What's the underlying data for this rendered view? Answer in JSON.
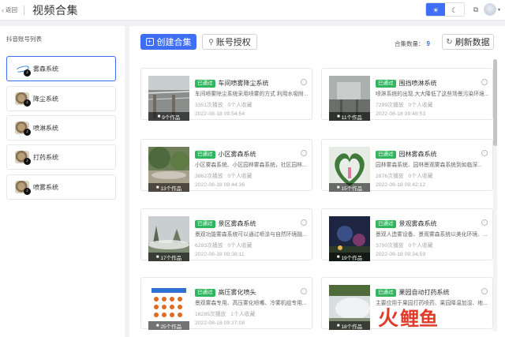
{
  "header": {
    "back_label": "返回",
    "title": "视频合集"
  },
  "sidebar": {
    "title": "抖音账号列表",
    "items": [
      {
        "label": "雾森系统",
        "logo": "blue-swoosh-logo",
        "active": true
      },
      {
        "label": "降尘系统",
        "logo": "circular-photo-logo",
        "active": false
      },
      {
        "label": "喷淋系统",
        "logo": "circular-photo-logo",
        "active": false
      },
      {
        "label": "打药系统",
        "logo": "circular-photo-logo",
        "active": false
      },
      {
        "label": "喷雾系统",
        "logo": "circular-photo-logo",
        "active": false
      }
    ]
  },
  "toolbar": {
    "create_label": "创建合集",
    "auth_label": "账号授权",
    "count_label": "合集数量：",
    "count_value": "9",
    "refresh_label": "刷新数据"
  },
  "cards": [
    {
      "tag": "已通过",
      "title": "车间喷雾降尘系统",
      "desc": "车间喷雾除尘系统采用喷雾的方式 利用水吸附...",
      "plays": "3351次播放",
      "favs": "0个人收藏",
      "date": "2022-08-18 09:54:54",
      "works": "9个作品"
    },
    {
      "tag": "已通过",
      "title": "围挡喷淋系统",
      "desc": "喷淋系统的出现,大大降低了这些场景污染环境...",
      "plays": "7299次播放",
      "favs": "0个人收藏",
      "date": "2022-08-18 09:48:53",
      "works": "11个作品"
    },
    {
      "tag": "已通过",
      "title": "小区雾森系统",
      "desc": "小区雾森系统、小区园林雾森系统，社区园林...",
      "plays": "3862次播放",
      "favs": "0个人收藏",
      "date": "2022-08-18 09:44:36",
      "works": "13个作品"
    },
    {
      "tag": "已通过",
      "title": "园林雾森系统",
      "desc": "园林雾森系统、园林景观雾森系统到如临深...",
      "plays": "2876次播放",
      "favs": "0个人收藏",
      "date": "2022-08-18 09:42:12",
      "works": "15个作品"
    },
    {
      "tag": "已通过",
      "title": "景区雾森系统",
      "desc": "景观功能雾森系统可以通过喷涂与自然环境融...",
      "plays": "6283次播放",
      "favs": "0个人收藏",
      "date": "2022-08-18 09:38:11",
      "works": "17个作品"
    },
    {
      "tag": "已通过",
      "title": "景观雾森系统",
      "desc": "景观人造雾设备、景观雾森系统以美化环境、...",
      "plays": "3790次播放",
      "favs": "0个人收藏",
      "date": "2022-08-18 09:34:59",
      "works": "19个作品"
    },
    {
      "tag": "已通过",
      "title": "高压雾化喷头",
      "desc": "景观雾森专用、高压雾化喷嘴、冷雾机组专用...",
      "plays": "16285次播放",
      "favs": "1个人收藏",
      "date": "2022-08-18 09:27:08",
      "works": "25个作品"
    },
    {
      "tag": "已通过",
      "title": "果园自动打药系统",
      "desc": "主要应用于果园打药喷药、果园降温加湿、地...",
      "plays": "",
      "favs": "",
      "date": "",
      "works": "18个作品"
    }
  ],
  "colors": {
    "accent": "#3d6ef5",
    "approved": "#31b65f",
    "watermark": "#e23b2b"
  },
  "watermark": {
    "glyph1": "火",
    "glyph2": "鲤鱼"
  }
}
